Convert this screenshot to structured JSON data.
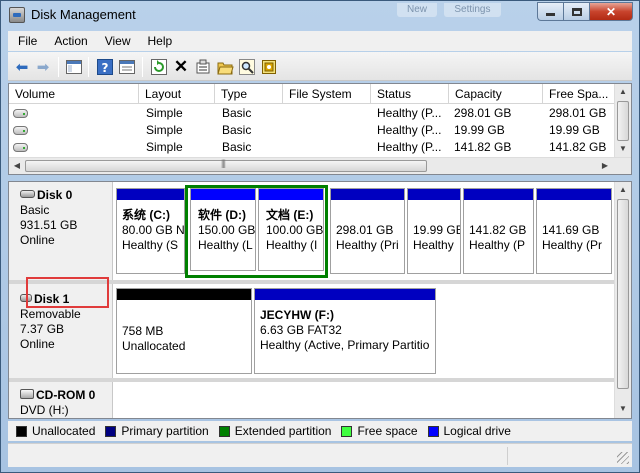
{
  "window": {
    "title": "Disk Management",
    "ghost_tabs": [
      "New",
      "Settings"
    ],
    "close_glyph": "✕"
  },
  "menu": [
    "File",
    "Action",
    "View",
    "Help"
  ],
  "toolbar": {
    "icons": [
      "back-icon",
      "forward-icon",
      "console-tree-icon",
      "help-icon",
      "properties-icon",
      "refresh-icon",
      "delete-icon",
      "settings-icon",
      "open-icon",
      "search-icon",
      "export-icon"
    ]
  },
  "volume_list": {
    "columns": [
      "Volume",
      "Layout",
      "Type",
      "File System",
      "Status",
      "Capacity",
      "Free Spa..."
    ],
    "rows": [
      {
        "layout": "Simple",
        "type": "Basic",
        "fs": "",
        "status": "Healthy (P...",
        "capacity": "298.01 GB",
        "free": "298.01 GB"
      },
      {
        "layout": "Simple",
        "type": "Basic",
        "fs": "",
        "status": "Healthy (P...",
        "capacity": "19.99 GB",
        "free": "19.99 GB"
      },
      {
        "layout": "Simple",
        "type": "Basic",
        "fs": "",
        "status": "Healthy (P...",
        "capacity": "141.82 GB",
        "free": "141.82 GB"
      }
    ]
  },
  "disks": [
    {
      "name": "Disk 0",
      "type": "Basic",
      "size": "931.51 GB",
      "state": "Online",
      "partitions": [
        {
          "label": "系统  (C:)",
          "line2": "80.00 GB N",
          "line3": "Healthy (S",
          "color": "#0000c0"
        },
        {
          "label": "软件  (D:)",
          "line2": "150.00 GB",
          "line3": "Healthy (L",
          "color": "#0000ff"
        },
        {
          "label": "文档  (E:)",
          "line2": "100.00 GB",
          "line3": "Healthy (I",
          "color": "#0000ff"
        },
        {
          "label": "",
          "line2": "298.01 GB",
          "line3": "Healthy (Pri",
          "color": "#0000c0"
        },
        {
          "label": "",
          "line2": "19.99 GB",
          "line3": "Healthy",
          "color": "#0000c0"
        },
        {
          "label": "",
          "line2": "141.82 GB",
          "line3": "Healthy (P",
          "color": "#0000c0"
        },
        {
          "label": "",
          "line2": "141.69 GB",
          "line3": "Healthy (Pr",
          "color": "#0000c0"
        }
      ]
    },
    {
      "name": "Disk 1",
      "type": "Removable",
      "size": "7.37 GB",
      "state": "Online",
      "partitions": [
        {
          "label": "",
          "line2": "758 MB",
          "line3": "Unallocated",
          "color": "#000000"
        },
        {
          "label": "JECYHW  (F:)",
          "line2": "6.63 GB FAT32",
          "line3": "Healthy (Active, Primary Partitio",
          "color": "#0000c0"
        }
      ]
    },
    {
      "name": "CD-ROM 0",
      "type": "DVD (H:)",
      "size": "",
      "state": "",
      "partitions": []
    }
  ],
  "legend": [
    {
      "label": "Unallocated",
      "color": "#000000"
    },
    {
      "label": "Primary partition",
      "color": "#000080"
    },
    {
      "label": "Extended partition",
      "color": "#008000"
    },
    {
      "label": "Free space",
      "color": "#40ff40"
    },
    {
      "label": "Logical drive",
      "color": "#0000ff"
    }
  ],
  "colors": {
    "extended_outline": "#008000",
    "highlight_box": "#e03b3b"
  }
}
